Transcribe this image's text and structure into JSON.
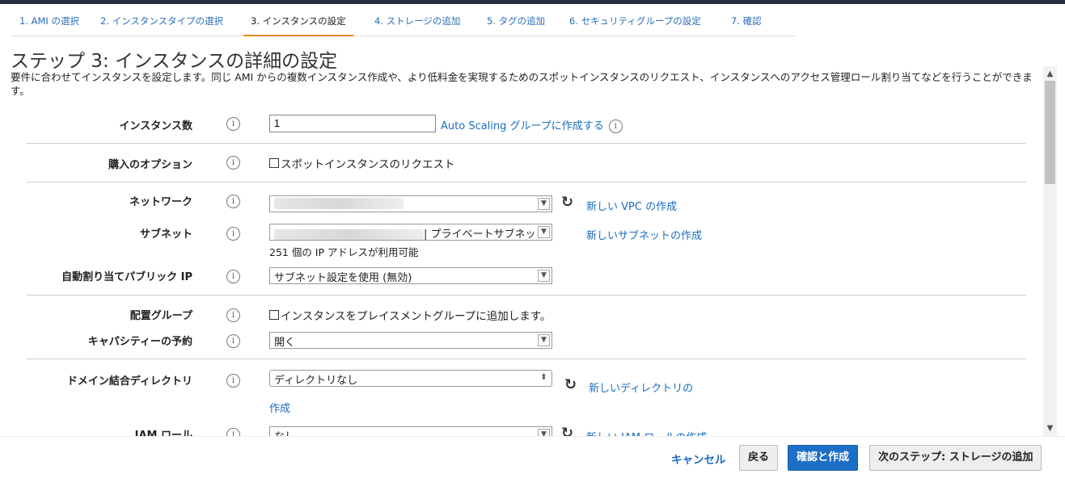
{
  "tabs": [
    {
      "label": "1. AMI の選択"
    },
    {
      "label": "2. インスタンスタイプの選択"
    },
    {
      "label": "3. インスタンスの設定"
    },
    {
      "label": "4. ストレージの追加"
    },
    {
      "label": "5. タグの追加"
    },
    {
      "label": "6. セキュリティグループの設定"
    },
    {
      "label": "7. 確認"
    }
  ],
  "page": {
    "title": "ステップ 3: インスタンスの詳細の設定",
    "description": "要件に合わせてインスタンスを設定します。同じ AMI からの複数インスタンス作成や、より低料金を実現するためのスポットインスタンスのリクエスト、インスタンスへのアクセス管理ロール割り当てなどを行うことができます。"
  },
  "form": {
    "instance_count": {
      "label": "インスタンス数",
      "value": "1",
      "link": "Auto Scaling グループに作成する"
    },
    "purchase_option": {
      "label": "購入のオプション",
      "checkbox_label": "スポットインスタンスのリクエスト"
    },
    "network": {
      "label": "ネットワーク",
      "link": "新しい VPC の作成"
    },
    "subnet": {
      "label": "サブネット",
      "value_suffix": "| プライベートサブネッ",
      "note": "251 個の IP アドレスが利用可能",
      "link": "新しいサブネットの作成"
    },
    "auto_public_ip": {
      "label": "自動割り当てパブリック IP",
      "value": "サブネット設定を使用 (無効)"
    },
    "placement_group": {
      "label": "配置グループ",
      "checkbox_label": "インスタンスをプレイスメントグループに追加します。"
    },
    "capacity_reservation": {
      "label": "キャパシティーの予約",
      "value": "開く"
    },
    "domain_directory": {
      "label": "ドメイン結合ディレクトリ",
      "value": "ディレクトリなし",
      "link_line1": "新しいディレクトリの",
      "link_line2": "作成"
    },
    "iam_role": {
      "label": "IAM ロール",
      "value": "なし",
      "link": "新しい IAM ロールの作成"
    }
  },
  "footer": {
    "cancel": "キャンセル",
    "back": "戻る",
    "review_launch": "確認と作成",
    "next": "次のステップ: ストレージの追加"
  },
  "icons": {
    "info": "info-icon",
    "refresh": "refresh-icon",
    "dropdown": "chevron-down-icon"
  },
  "colors": {
    "link": "#1a6cbf",
    "active_tab_underline": "#e88a1a",
    "primary_button": "#1c6fc7",
    "topbar": "#232f3e"
  }
}
